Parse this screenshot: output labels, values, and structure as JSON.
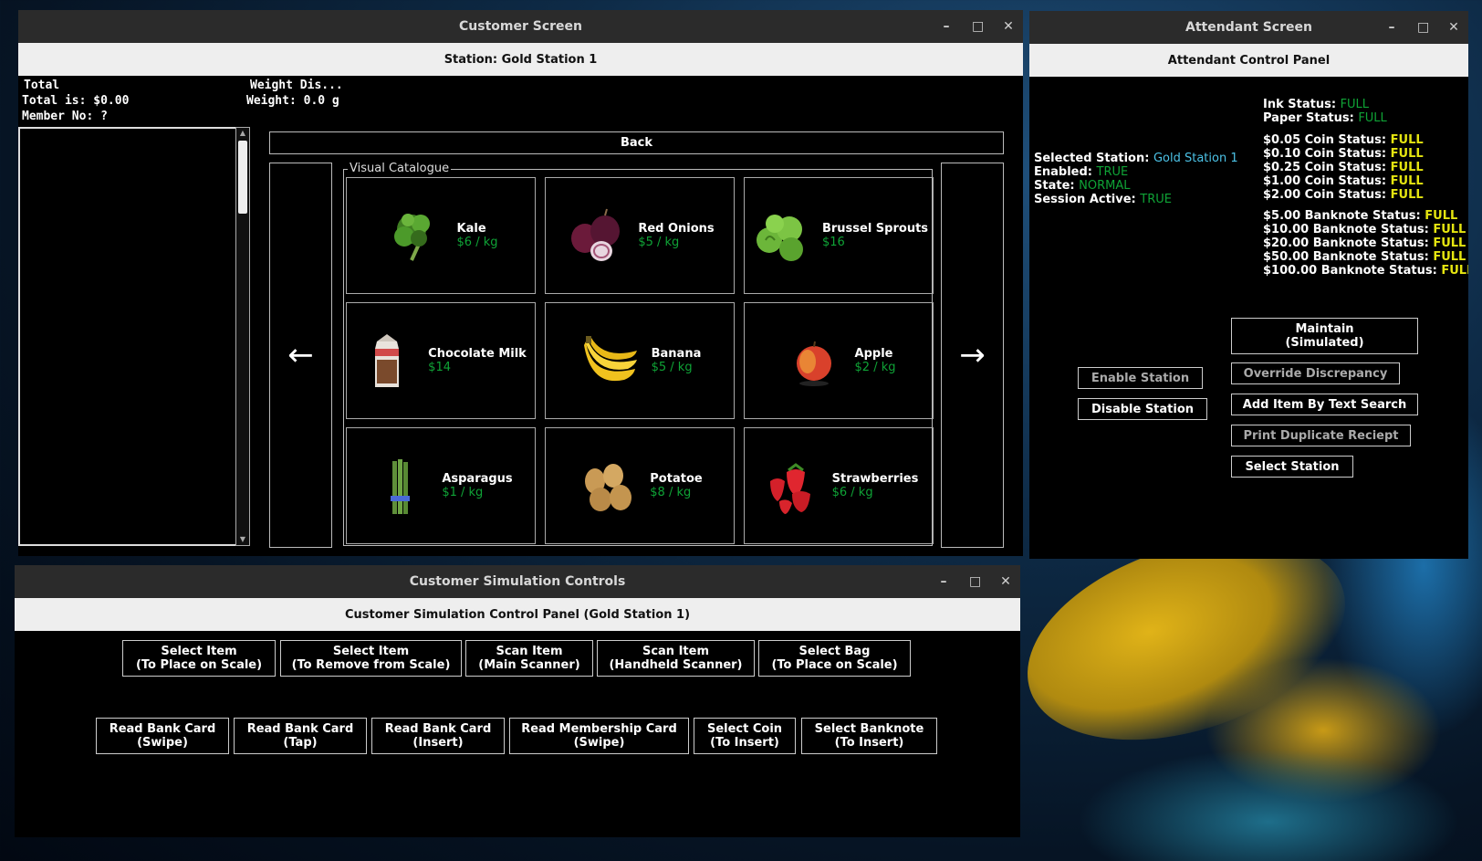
{
  "colors": {
    "price_green": "#0fa336",
    "status_yellow": "#e5e510",
    "station_cyan": "#4cc2e6",
    "window_bg": "#000000"
  },
  "customer_screen": {
    "title": "Customer Screen",
    "station_label": "Station: Gold Station 1",
    "total_header": "Total",
    "total_value": "Total is: $0.00",
    "member_no": "Member No: ?",
    "weight_header": "Weight Dis...",
    "weight_value": "Weight: 0.0 g",
    "back_label": "Back",
    "left_arrow": "←",
    "right_arrow": "→",
    "catalogue_title": "Visual Catalogue",
    "items": [
      {
        "name": "Kale",
        "price": "$6 / kg",
        "icon": "kale-icon"
      },
      {
        "name": "Red Onions",
        "price": "$5 / kg",
        "icon": "red-onion-icon"
      },
      {
        "name": "Brussel Sprouts",
        "price": "$16",
        "icon": "brussel-sprouts-icon"
      },
      {
        "name": "Chocolate Milk",
        "price": "$14",
        "icon": "chocolate-milk-icon"
      },
      {
        "name": "Banana",
        "price": "$5 / kg",
        "icon": "banana-icon"
      },
      {
        "name": "Apple",
        "price": "$2 / kg",
        "icon": "apple-icon"
      },
      {
        "name": "Asparagus",
        "price": "$1 / kg",
        "icon": "asparagus-icon"
      },
      {
        "name": "Potatoe",
        "price": "$8 / kg",
        "icon": "potato-icon"
      },
      {
        "name": "Strawberries",
        "price": "$6 / kg",
        "icon": "strawberries-icon"
      }
    ]
  },
  "attendant_screen": {
    "title": "Attendant Screen",
    "panel_label": "Attendant Control Panel",
    "ink_label": "Ink Status:",
    "ink_value": "FULL",
    "paper_label": "Paper Status:",
    "paper_value": "FULL",
    "selected_station_label": "Selected Station:",
    "selected_station_value": "Gold Station 1",
    "enabled_label": "Enabled:",
    "enabled_value": "TRUE",
    "state_label": "State:",
    "state_value": "NORMAL",
    "session_label": "Session Active:",
    "session_value": "TRUE",
    "coins": [
      {
        "label": "$0.05 Coin Status:",
        "value": "FULL"
      },
      {
        "label": "$0.10 Coin Status:",
        "value": "FULL"
      },
      {
        "label": "$0.25 Coin Status:",
        "value": "FULL"
      },
      {
        "label": "$1.00 Coin Status:",
        "value": "FULL"
      },
      {
        "label": "$2.00 Coin Status:",
        "value": "FULL"
      }
    ],
    "banknotes": [
      {
        "label": "$5.00 Banknote Status:",
        "value": "FULL"
      },
      {
        "label": "$10.00 Banknote Status:",
        "value": "FULL"
      },
      {
        "label": "$20.00 Banknote Status:",
        "value": "FULL"
      },
      {
        "label": "$50.00 Banknote Status:",
        "value": "FULL"
      },
      {
        "label": "$100.00 Banknote Status:",
        "value": "FULL"
      }
    ],
    "buttons": {
      "maintain_line1": "Maintain",
      "maintain_line2": "(Simulated)",
      "override": "Override Discrepancy",
      "enable": "Enable Station",
      "add_item": "Add Item By Text Search",
      "disable": "Disable Station",
      "print": "Print Duplicate Reciept",
      "select_station": "Select Station"
    }
  },
  "simulation": {
    "title": "Customer Simulation Controls",
    "panel_label": "Customer Simulation Control Panel (Gold Station 1)",
    "row1": [
      {
        "l1": "Select Item",
        "l2": "(To Place on Scale)"
      },
      {
        "l1": "Select Item",
        "l2": "(To Remove from Scale)"
      },
      {
        "l1": "Scan Item",
        "l2": "(Main Scanner)"
      },
      {
        "l1": "Scan Item",
        "l2": "(Handheld Scanner)"
      },
      {
        "l1": "Select Bag",
        "l2": "(To Place on Scale)"
      }
    ],
    "row2": [
      {
        "l1": "Read Bank Card",
        "l2": "(Swipe)"
      },
      {
        "l1": "Read Bank Card",
        "l2": "(Tap)"
      },
      {
        "l1": "Read Bank Card",
        "l2": "(Insert)"
      },
      {
        "l1": "Read Membership Card",
        "l2": "(Swipe)"
      },
      {
        "l1": "Select Coin",
        "l2": "(To Insert)"
      },
      {
        "l1": "Select Banknote",
        "l2": "(To Insert)"
      }
    ]
  },
  "window_controls": {
    "minimize": "–",
    "maximize": "□",
    "close": "✕"
  }
}
